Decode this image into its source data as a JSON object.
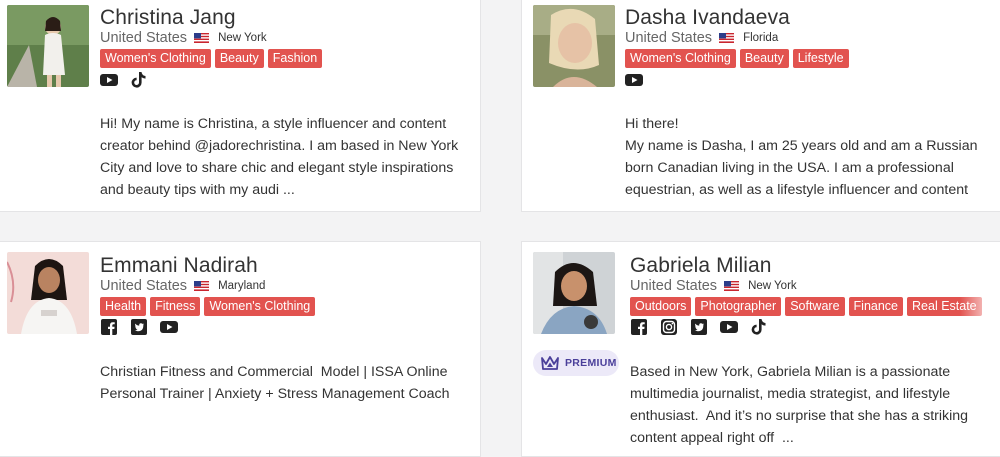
{
  "influencers": [
    {
      "name": "Christina Jang",
      "country": "United States",
      "region": "New York",
      "tags": [
        "Women's Clothing",
        "Beauty",
        "Fashion"
      ],
      "socials": [
        "youtube-icon",
        "tiktok-icon"
      ],
      "bio": [
        "Hi! My name is Christina, a style influencer and content",
        "creator behind @jadorechristina. I am based in New York",
        "City and love to share chic and elegant style inspirations",
        "and beauty tips with my audi ..."
      ]
    },
    {
      "name": "Dasha Ivandaeva",
      "country": "United States",
      "region": "Florida",
      "tags": [
        "Women's Clothing",
        "Beauty",
        "Lifestyle"
      ],
      "socials": [
        "youtube-icon"
      ],
      "bio": [
        "Hi there!",
        "My name is Dasha, I am 25 years old and am a Russian",
        "born Canadian living in the USA. I am a professional",
        "equestrian, as well as a lifestyle influencer and content"
      ]
    },
    {
      "name": "Emmani Nadirah",
      "country": "United States",
      "region": "Maryland",
      "tags": [
        "Health",
        "Fitness",
        "Women's Clothing"
      ],
      "socials": [
        "facebook-icon",
        "twitter-icon",
        "youtube-icon"
      ],
      "bio": [
        "Christian Fitness and Commercial  Model | ISSA Online",
        "Personal Trainer | Anxiety + Stress Management Coach"
      ]
    },
    {
      "name": "Gabriela Milian",
      "country": "United States",
      "region": "New York",
      "tags": [
        "Outdoors",
        "Photographer",
        "Software",
        "Finance",
        "Real Estate"
      ],
      "socials": [
        "facebook-icon",
        "instagram-icon",
        "twitter-icon",
        "youtube-icon",
        "tiktok-icon"
      ],
      "badge": "PREMIUM",
      "bio": [
        "Based in New York, Gabriela Milian is a passionate",
        "multimedia journalist, media strategist, and lifestyle",
        "enthusiast.  And it’s no surprise that she has a striking",
        "content appeal right off  ..."
      ]
    }
  ],
  "colors": {
    "tag": "#e2534f",
    "premium_bg": "#ece9f8",
    "premium_text": "#4a3f9a"
  }
}
